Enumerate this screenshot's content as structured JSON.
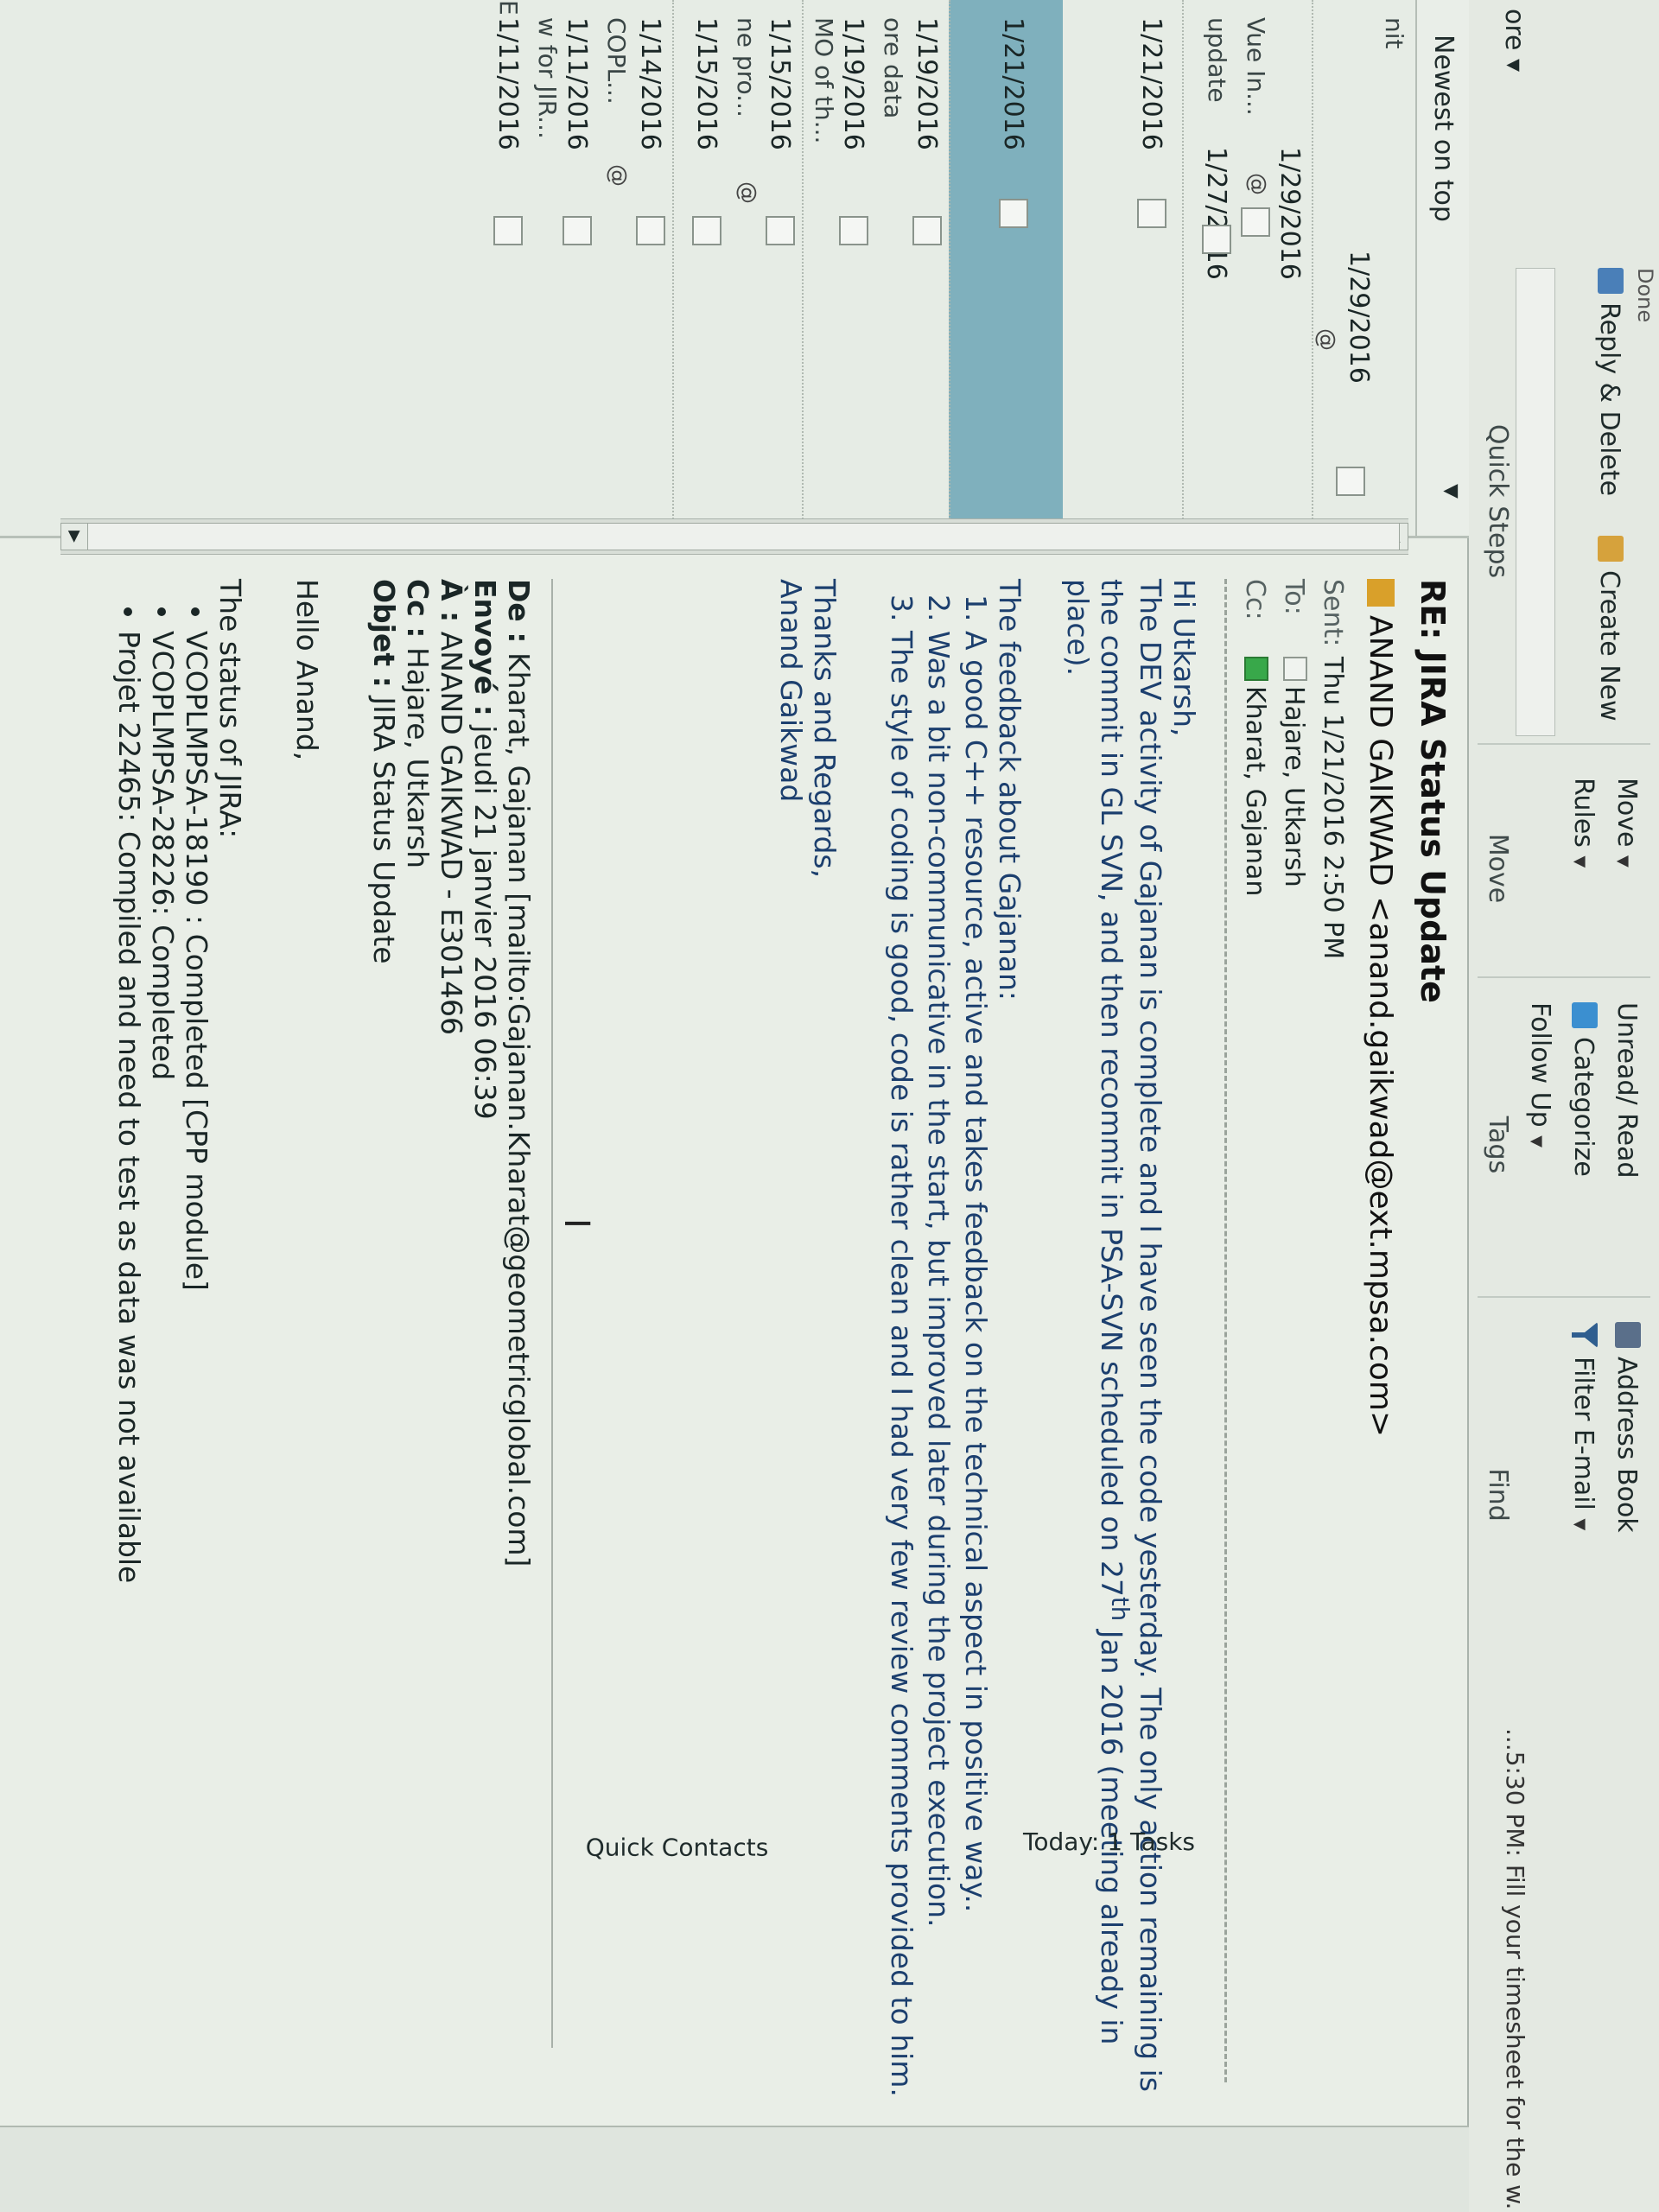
{
  "ribbon": {
    "top_left_label": "ore ▾",
    "quick_steps": {
      "items": [
        "Reply & Delete",
        "Create New"
      ],
      "top_partial": "Done",
      "group_label": "Quick Steps"
    },
    "move_group": {
      "move_label": "Move",
      "rules_label": "Rules",
      "group_label": "Move"
    },
    "tags_group": {
      "unread_label": "Unread/ Read",
      "categorize_label": "Categorize",
      "follow_label": "Follow Up",
      "group_label": "Tags"
    },
    "find_group": {
      "address_book_label": "Address Book",
      "filter_label": "Filter E-mail",
      "group_label": "Find"
    },
    "reminder_text": "...5:30 PM: Fill your timesheet for the w..."
  },
  "message_list": {
    "sort_label": "Newest on top",
    "rows": [
      {
        "date": "1/29/2016",
        "snippet": "nit"
      },
      {
        "date": "1/29/2016",
        "snippet": "Vue In..."
      },
      {
        "date": "1/27/2016",
        "snippet": "update"
      },
      {
        "date": "1/21/2016",
        "snippet": ""
      },
      {
        "date": "1/21/2016",
        "snippet": ""
      },
      {
        "date": "1/19/2016",
        "snippet": "ore data"
      },
      {
        "date": "1/19/2016",
        "snippet": "MO of th..."
      },
      {
        "date": "1/15/2016",
        "snippet": "ne pro..."
      },
      {
        "date": "1/15/2016",
        "snippet": ""
      },
      {
        "date": "1/14/2016",
        "snippet": "COPL..."
      },
      {
        "date": "1/11/2016",
        "snippet": "w for JIR..."
      },
      {
        "date": "1/11/2016",
        "snippet": "E"
      }
    ]
  },
  "email": {
    "subject": "RE: JIRA Status Update",
    "from": "ANAND GAIKWAD <anand.gaikwad@ext.mpsa.com>",
    "sent_label": "Sent:",
    "sent_value": "Thu 1/21/2016 2:50 PM",
    "to_label": "To:",
    "to_value": "Hajare, Utkarsh",
    "cc_label": "Cc:",
    "cc_value": "Kharat, Gajanan",
    "greeting": "Hi Utkarsh,",
    "para1a": "The DEV activity of Gajanan is complete and I have seen the code yesterday. The only action remaining is",
    "para1b": "the commit in GL SVN, and then recommit in PSA-SVN scheduled on 27",
    "para1_sup": "th",
    "para1c": " Jan 2016 (meeting already in place).",
    "feedback_intro": "The feedback about Gajanan:",
    "feedback": [
      "A good C++ resource, active and takes feedback on the technical aspect in positive way..",
      "Was a bit non-communicative in the start, but improved later during the project execution.",
      "The style of coding is good, code is rather clean and I had very few review comments provided to him."
    ],
    "closing1": "Thanks and Regards,",
    "closing2": "Anand Gaikwad",
    "quoted": {
      "de_label": "De :",
      "de_value": " Kharat, Gajanan [mailto:Gajanan.Kharat@geometricglobal.com]",
      "envoye_label": "Envoyé :",
      "envoye_value": " jeudi 21 janvier 2016 06:39",
      "a_label": "À :",
      "a_value": " ANAND GAIKWAD - E301466",
      "cc_label": "Cc :",
      "cc_value": " Hajare, Utkarsh",
      "objet_label": "Objet :",
      "objet_value": " JIRA Status Update",
      "hello": "Hello Anand,",
      "status_intro": "The status of JIRA:",
      "status_items": [
        "VCOPLMPSA-18190 : Completed [CPP module]",
        "VCOPLMPSA-28226: Completed",
        "Projet 22465: Compiled and need to test as data was not available"
      ]
    }
  },
  "todo_bar": {
    "tasks": "Today: 1 Tasks",
    "contacts": "Quick Contacts"
  },
  "colors": {
    "selected_row": "#7fb0bd",
    "sender_badge": "#d9a02a",
    "presence_green": "#38a84a"
  }
}
